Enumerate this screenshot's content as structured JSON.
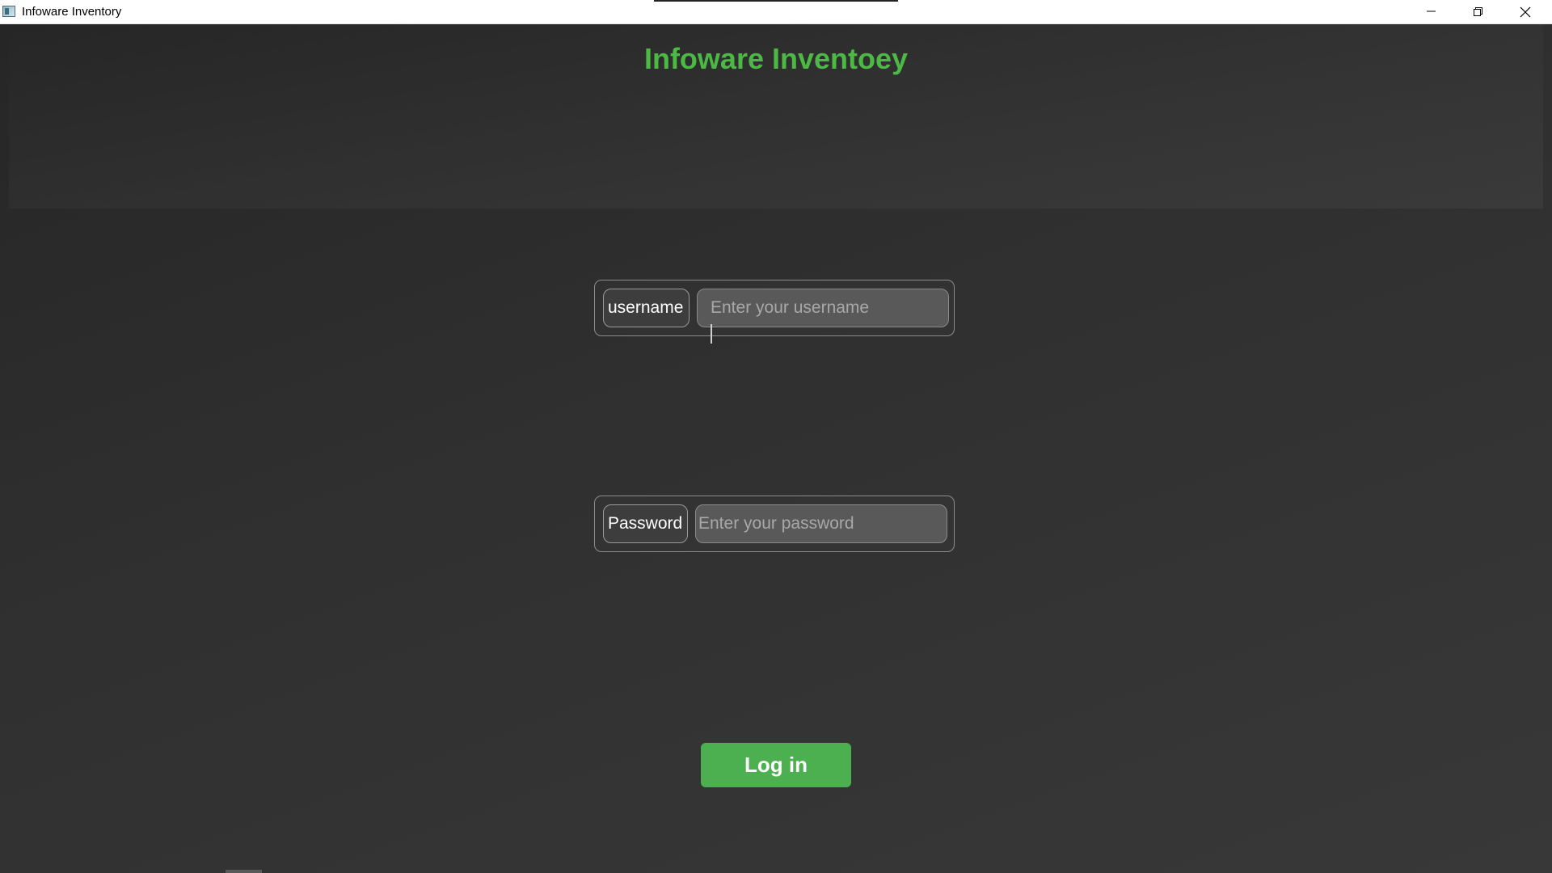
{
  "window": {
    "title": "Infoware Inventory",
    "controls": [
      "minimize-icon",
      "maximize-icon",
      "close-icon"
    ]
  },
  "header": {
    "title": "Infoware Inventoey"
  },
  "form": {
    "username": {
      "label": "username",
      "value": "",
      "placeholder": "Enter your username"
    },
    "password": {
      "label": "Password",
      "value": "",
      "placeholder": "Enter your password"
    },
    "login_label": "Log in"
  },
  "colors": {
    "accent_green": "#4cb944",
    "button_green": "#4caf50",
    "background_dark": "#2c2c2c",
    "input_fill": "#595959"
  }
}
